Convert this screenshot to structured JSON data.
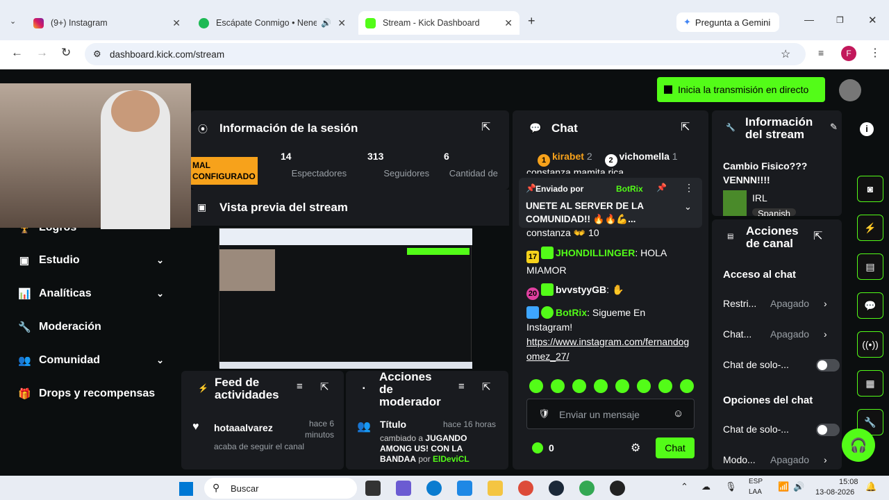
{
  "browser": {
    "tabs": [
      {
        "title": "(9+) Instagram"
      },
      {
        "title": "Escápate Conmigo • Nene M"
      },
      {
        "title": "Stream - Kick Dashboard"
      }
    ],
    "gemini": "Pregunta a Gemini",
    "url": "dashboard.kick.com/stream",
    "profile_initial": "F"
  },
  "header": {
    "go_live": "Inicia la transmisión en directo"
  },
  "sidebar": {
    "items": [
      {
        "label": "Logros"
      },
      {
        "label": "Estudio"
      },
      {
        "label": "Analíticas"
      },
      {
        "label": "Moderación"
      },
      {
        "label": "Comunidad"
      },
      {
        "label": "Drops y recompensas"
      }
    ]
  },
  "session": {
    "title": "Información de la sesión",
    "status": "MAL CONFIGURADO",
    "viewers": "14",
    "viewers_label": "Espectadores",
    "followers": "313",
    "followers_label": "Seguidores",
    "count": "6",
    "count_label": "Cantidad de"
  },
  "preview": {
    "title": "Vista previa del stream"
  },
  "feed": {
    "title": "Feed de actividades",
    "user": "hotaaalvarez",
    "time": "hace 6 minutos",
    "action": "acaba de seguir el canal"
  },
  "modactions": {
    "title": "Acciones de moderador",
    "item_title": "Título",
    "time": "hace 16 horas",
    "changed": "cambiado a",
    "new_title": "JUGANDO AMONG US! CON LA BANDAA",
    "by": "por",
    "mod": "ElDeviCL"
  },
  "chat": {
    "title": "Chat",
    "top": [
      {
        "rank": "1",
        "name": "kirabet",
        "count": "2"
      },
      {
        "rank": "2",
        "name": "vichomella",
        "count": "1"
      }
    ],
    "partial_line": "constanza mamita rica",
    "pinned_by": "Enviado por",
    "pinned_user": "BotRix",
    "pinned_msg": "UNETE AL SERVER DE LA COMUNIDAD!! 🔥🔥💪...",
    "partial2": "constanza 👐 10",
    "messages": [
      {
        "badge": "17",
        "user": "JHONDILLINGER",
        "text": "HOLA MIAMOR",
        "color": "#53fc18"
      },
      {
        "badge": "20",
        "user": "bvvstyyGB",
        "text": "✋",
        "color": "#ffffff"
      },
      {
        "badge": "",
        "user": "BotRix",
        "text": "Sigueme En Instagram!",
        "link": "https://www.instagram.com/fernandogomez_27/",
        "color": "#53fc18"
      }
    ],
    "placeholder": "Enviar un mensaje",
    "points": "0",
    "send": "Chat"
  },
  "streaminfo": {
    "title": "Información del stream",
    "stream_title": "Cambio Fisico??? VENNN!!!!",
    "category": "IRL",
    "language": "Spanish"
  },
  "channel": {
    "title": "Acciones de canal",
    "access": "Acceso al chat",
    "rows": [
      {
        "label": "Restri...",
        "value": "Apagado"
      },
      {
        "label": "Chat...",
        "value": "Apagado"
      },
      {
        "label": "Chat de solo-..."
      }
    ],
    "options": "Opciones del chat",
    "rows2": [
      {
        "label": "Chat de solo-..."
      },
      {
        "label": "Modo...",
        "value": "Apagado"
      }
    ]
  },
  "taskbar": {
    "search": "Buscar",
    "lang": "ESP",
    "region": "LAA",
    "time": "15:08",
    "date": "13-08-2026"
  }
}
